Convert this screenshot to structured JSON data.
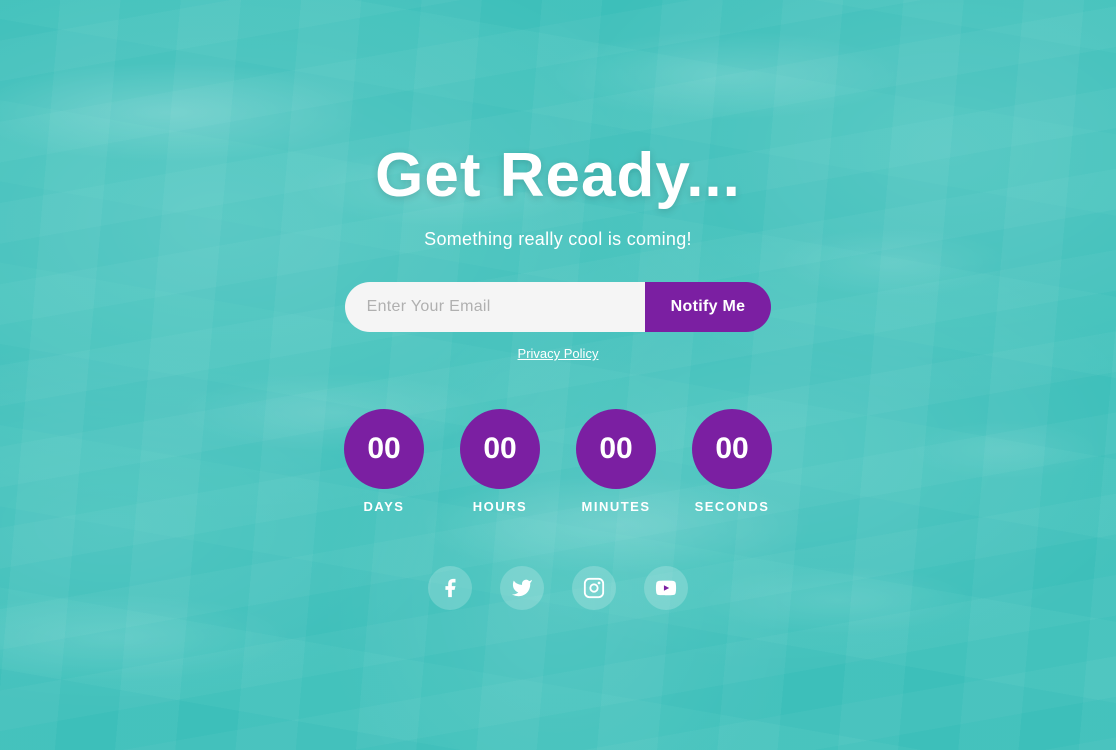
{
  "background": {
    "color": "#3dbfba"
  },
  "headline": "Get Ready...",
  "subheadline": "Something really cool is coming!",
  "email_form": {
    "input_placeholder": "Enter Your Email",
    "button_label": "Notify Me"
  },
  "privacy": {
    "label": "Privacy Policy"
  },
  "countdown": {
    "days": {
      "value": "00",
      "label": "DAYS"
    },
    "hours": {
      "value": "00",
      "label": "HOURS"
    },
    "minutes": {
      "value": "00",
      "label": "MINUTES"
    },
    "seconds": {
      "value": "00",
      "label": "SECONDS"
    }
  },
  "social": {
    "facebook_label": "Facebook",
    "twitter_label": "Twitter",
    "instagram_label": "Instagram",
    "youtube_label": "YouTube"
  },
  "colors": {
    "purple": "#7b1fa2",
    "teal_bg": "#3dbfba"
  }
}
